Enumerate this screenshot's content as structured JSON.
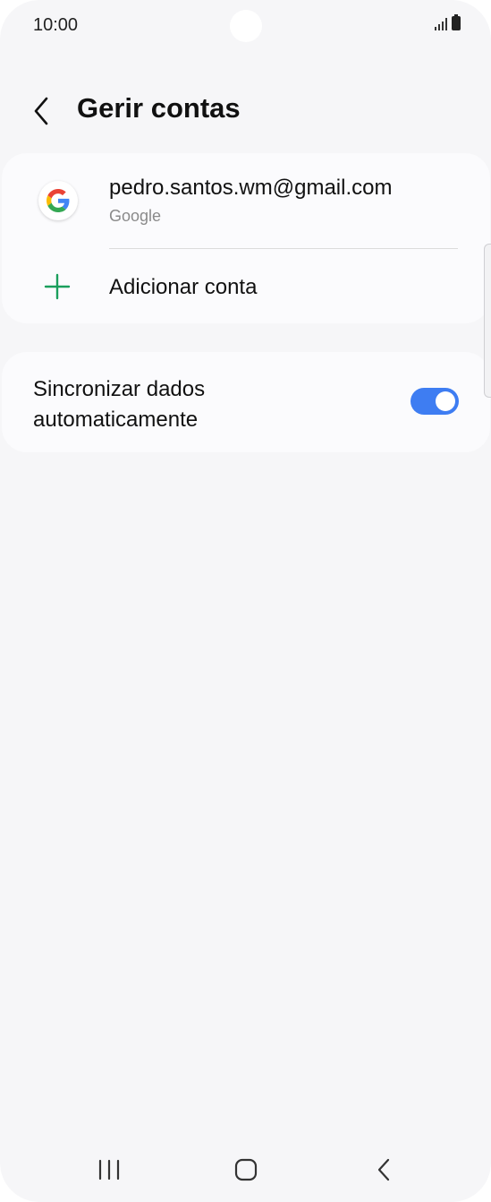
{
  "status_bar": {
    "time": "10:00"
  },
  "header": {
    "title": "Gerir contas",
    "back_icon": "chevron-left-icon"
  },
  "accounts": {
    "items": [
      {
        "email": "pedro.santos.wm@gmail.com",
        "type": "Google",
        "icon": "google-g-icon"
      }
    ],
    "add_account_label": "Adicionar conta",
    "add_icon": "plus-icon",
    "add_icon_color": "#1a9e5c"
  },
  "sync": {
    "label_line1": "Sincronizar dados",
    "label_line2": "automaticamente",
    "enabled": true,
    "toggle_color": "#3e7df2"
  },
  "nav_bar": {
    "recents_icon": "recent-apps-icon",
    "home_icon": "home-icon",
    "back_icon": "back-icon"
  }
}
